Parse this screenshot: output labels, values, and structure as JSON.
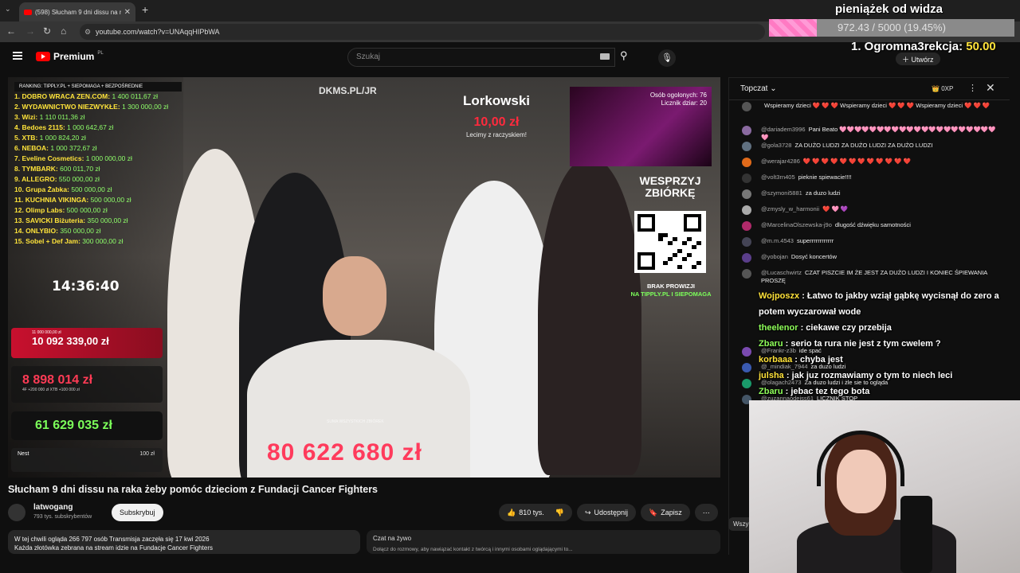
{
  "browser": {
    "tab_title": "(598) Słucham 9 dni dissu na raka żeby...",
    "url": "youtube.com/watch?v=UNAqqHIPbWA"
  },
  "youtube": {
    "logo_text": "Premium",
    "logo_region": "PL",
    "search_placeholder": "Szukaj",
    "create_label": "Utwórz"
  },
  "stream_overlay": {
    "ranking_header": "RANKING: TIPPLY.PL + SIEPOMAGA + BEZPOŚREDNIE",
    "ranking": [
      {
        "name": "1. DOBRO WRACA ZEN.COM:",
        "amount": "1 400 011,67 zł"
      },
      {
        "name": "2. WYDAWNICTWO NIEZWYKŁE:",
        "amount": "1 300 000,00 zł"
      },
      {
        "name": "3. Wizi:",
        "amount": "1 110 011,36 zł"
      },
      {
        "name": "4. Bedoes 2115:",
        "amount": "1 000 642,67 zł"
      },
      {
        "name": "5. XTB:",
        "amount": "1 000 824,20 zł"
      },
      {
        "name": "6. NEBOA:",
        "amount": "1 000 372,67 zł"
      },
      {
        "name": "7. Eveline Cosmetics:",
        "amount": "1 000 000,00 zł"
      },
      {
        "name": "8. TYMBARK:",
        "amount": "600 011,70 zł"
      },
      {
        "name": "9. ALLEGRO:",
        "amount": "550 000,00 zł"
      },
      {
        "name": "10. Grupa Żabka:",
        "amount": "500 000,00 zł"
      },
      {
        "name": "11. KUCHNIA VIKINGA:",
        "amount": "500 000,00 zł"
      },
      {
        "name": "12. Olimp Labs:",
        "amount": "500 000,00 zł"
      },
      {
        "name": "13. SAVICKI Biżuteria:",
        "amount": "350 000,00 zł"
      },
      {
        "name": "14. ONLYBIO:",
        "amount": "350 000,00 zł"
      },
      {
        "name": "15. Sobel + Def Jam:",
        "amount": "300 000,00 zł"
      }
    ],
    "clock": "14:36:40",
    "goal_small": "11 000 000,00 zł",
    "goal_amount": "10 092 339,00 zł",
    "direct_amount": "8 898 014 zł",
    "direct_sub": "4F +200 000 zł   XTB +100 000 zł",
    "total_box": "61 629 035 zł",
    "nest_label": "Nest",
    "nest_amount": "100 zł",
    "dkms": "DKMS.PL/JR",
    "lorkowski_name": "Lorkowski",
    "lorkowski_amount": "10,00 zł",
    "lorkowski_msg": "Lecimy z raczyskiem!",
    "pip_stats": "Osób ogolonych: 76\nLicznik dziar: 20",
    "wesprzyj": "WESPRZYJ ZBIÓRKĘ",
    "brak": "BRAK PROWIZJI",
    "brak2": "NA TIPPLY.PL I SIEPOMAGA",
    "sum_label": "SUMA WSZYSTKICH ZBIÓREK",
    "big_total": "80 622 680 zł"
  },
  "video_info": {
    "title": "Słucham 9 dni dissu na raka żeby pomóc dzieciom z Fundacji Cancer Fighters",
    "channel": "latwogang",
    "subscribers": "793 tys. subskrybentów",
    "subscribe": "Subskrybuj",
    "likes": "810 tys.",
    "share": "Udostępnij",
    "save": "Zapisz",
    "desc_line1": "W tej chwili ogląda 266 797 osób  Transmisja zaczęła się 17 kwi 2026",
    "desc_line2": "Każda złotówka zebrana na stream idzie na Fundacje Cancer Fighters",
    "livechat_label": "Czat na żywo",
    "livechat_sub": "Dołącz do rozmowy, aby nawiązać kontakt z twórcą i innymi osobami oglądającymi to..."
  },
  "chat": {
    "header": "Topczat",
    "points": "0XP",
    "messages": [
      {
        "user": "",
        "text": "Wspieramy dzieci ❤️ ❤️ ❤️ Wspieramy dzieci ❤️ ❤️ ❤️ Wspieramy dzieci ❤️ ❤️ ❤️",
        "color": "#555"
      },
      {
        "user": "@dariadem3996",
        "text": "Pani Beato 🩷🩷🩷🩷🩷🩷🩷🩷🩷🩷🩷🩷🩷🩷🩷🩷🩷🩷🩷🩷🩷🩷",
        "color": "#8a6aa0"
      },
      {
        "user": "@gola3728",
        "text": "ZA DUŻO LUDZI ZA DUŻO LUDZI ZA DUŻO LUDZI",
        "color": "#607080"
      },
      {
        "user": "@werajar4286",
        "text": "❤️ ❤️ ❤️ ❤️ ❤️ ❤️ ❤️ ❤️ ❤️ ❤️ ❤️ ❤️",
        "color": "#e06a1a"
      },
      {
        "user": "@volt3rn405",
        "text": "pieknie spiewacie!!!!",
        "color": "#333"
      },
      {
        "user": "@szymoni5881",
        "text": "za duzo ludzi",
        "color": "#777"
      },
      {
        "user": "@zmysly_w_harmonii",
        "text": "❤️ 🩷 💜",
        "color": "#aaa"
      },
      {
        "user": "@MarcelinaOlszewska-j9o",
        "text": "dlugość dźwięku samotności",
        "color": "#b02a6a"
      },
      {
        "user": "@m.m.4543",
        "text": "superrrrrrrrrrrr",
        "color": "#445"
      },
      {
        "user": "@yobojan",
        "text": "Dosyć koncertów",
        "color": "#5a3e8a"
      },
      {
        "user": "@Lucaschwirtz",
        "text": "CZAT PISZCIE IM ŻE JEST ZA DUŻO LUDZI I KONIEC ŚPIEWANIA PROSZĘ",
        "color": "#555"
      }
    ],
    "lower_messages": [
      {
        "user": "@Frankr-z3b",
        "text": "ide spać",
        "color": "#7a4ab0"
      },
      {
        "user": "@_mindiak_7944",
        "text": "za duzo ludzi",
        "color": "#3a5ab0"
      },
      {
        "user": "@olagach2473",
        "text": "Za duzo ludzi i żle sie to ogląda",
        "color": "#1a9a6a"
      },
      {
        "user": "@zuzannaodejss61",
        "text": "LICZNIK STOP",
        "color": "#456"
      }
    ],
    "overlay": [
      {
        "user": "Wojposzx",
        "text": ": Łatwo to jakby wziął gąbkę wycisnął do zero a potem wyczarował wode",
        "green": false
      },
      {
        "user": "theelenor",
        "text": ": ciekawe czy przebija",
        "green": true
      },
      {
        "user": "Zbaru",
        "text": ": serio ta rura nie jest z tym cwelem ?",
        "green": true
      },
      {
        "user": "korbaaa",
        "text": ": chyba jest",
        "green": false
      },
      {
        "user": "julsha",
        "text": ": jak juz rozmawiamy o tym to niech leci",
        "green": false
      },
      {
        "user": "Zbaru",
        "text": ": jebac tez tego bota",
        "green": true
      }
    ],
    "all_label": "Wszy"
  },
  "donation": {
    "title": "pieniążek od widza",
    "progress": "972.43 / 5000 (19.45%)",
    "progress_fraction": 0.1945,
    "ticker_name": "1. Ogromna3rekcja:",
    "ticker_amount": "50.00"
  }
}
